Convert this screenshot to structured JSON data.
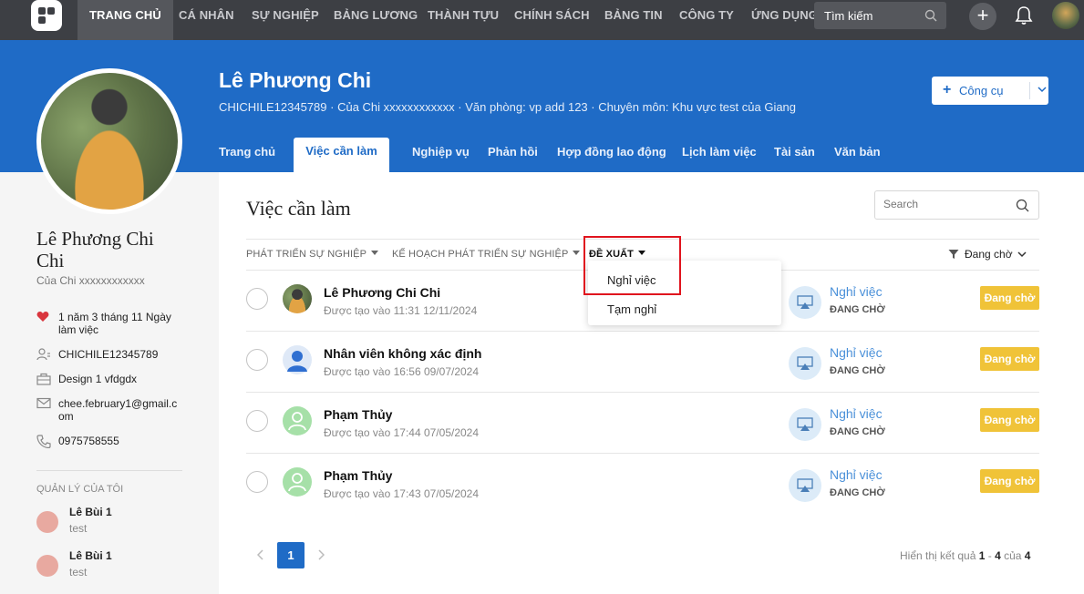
{
  "nav": {
    "items": [
      "TRANG CHỦ",
      "CÁ NHÂN",
      "SỰ NGHIỆP",
      "BẢNG LƯƠNG",
      "THÀNH TỰU",
      "CHÍNH SÁCH",
      "BẢNG TIN",
      "CÔNG TY",
      "ỨNG DỤNG"
    ],
    "active": "TRANG CHỦ",
    "search_placeholder": "Tìm kiếm"
  },
  "profile": {
    "name": "Lê Phương Chi",
    "left_name": "Lê Phương Chi Chi",
    "company": "Của Chi xxxxxxxxxxxx",
    "subtitle": "CHICHILE12345789 · Của Chi xxxxxxxxxxxx · Văn phòng: vp add 123 · Chuyên môn: Khu vực test của Giang",
    "tenure": "1 năm 3 tháng 11 Ngày làm việc",
    "employee_code": "CHICHILE12345789",
    "position": "Design 1 vfdgdx",
    "email": "chee.february1@gmail.com",
    "phone": "0975758555",
    "tools_label": "Công cụ"
  },
  "tabs": [
    "Trang chủ",
    "Việc cần làm",
    "Nghiệp vụ",
    "Phản hồi",
    "Hợp đồng lao động",
    "Lịch làm việc",
    "Tài sản",
    "Văn bản"
  ],
  "managers": {
    "title": "QUẢN LÝ CỦA TÔI",
    "items": [
      {
        "name": "Lê Bùi 1",
        "sub": "test"
      },
      {
        "name": "Lê Bùi 1",
        "sub": "test"
      }
    ]
  },
  "todo": {
    "title": "Việc cần làm",
    "search_placeholder": "Search",
    "filters": [
      "PHÁT TRIỂN SỰ NGHIỆP",
      "KẾ HOẠCH PHÁT TRIỂN SỰ NGHIỆP",
      "ĐỀ XUẤT"
    ],
    "status_filter": "Đang chờ",
    "dropdown_options": [
      "Nghỉ việc",
      "Tạm nghỉ"
    ],
    "rows": [
      {
        "name": "Lê Phương Chi Chi",
        "created": "Được tạo vào 11:31 12/11/2024",
        "type": "Nghỉ việc",
        "type_status": "ĐANG CHỜ",
        "badge": "Đang chờ"
      },
      {
        "name": "Nhân viên không xác định",
        "created": "Được tạo vào 16:56 09/07/2024",
        "type": "Nghỉ việc",
        "type_status": "ĐANG CHỜ",
        "badge": "Đang chờ"
      },
      {
        "name": "Phạm Thủy",
        "created": "Được tạo vào 17:44 07/05/2024",
        "type": "Nghỉ việc",
        "type_status": "ĐANG CHỜ",
        "badge": "Đang chờ"
      },
      {
        "name": "Phạm Thủy",
        "created": "Được tạo vào 17:43 07/05/2024",
        "type": "Nghỉ việc",
        "type_status": "ĐANG CHỜ",
        "badge": "Đang chờ"
      }
    ]
  },
  "pagination": {
    "current": "1",
    "summary_prefix": "Hiển thị kết quả ",
    "from": "1",
    "dash": " - ",
    "to": "4",
    "of": " của ",
    "total": "4"
  },
  "colors": {
    "brand": "#1f6bc6",
    "nav": "#3d3f44",
    "pending": "#f0c338",
    "highlight": "#e0141e"
  },
  "icons": [
    "logo-icon",
    "search-icon",
    "plus-icon",
    "bell-icon",
    "heart-icon",
    "user-id-icon",
    "briefcase-icon",
    "mail-icon",
    "phone-icon",
    "funnel-icon",
    "chevron-down-icon",
    "airplay-icon",
    "chevron-left-icon",
    "chevron-right-icon"
  ]
}
